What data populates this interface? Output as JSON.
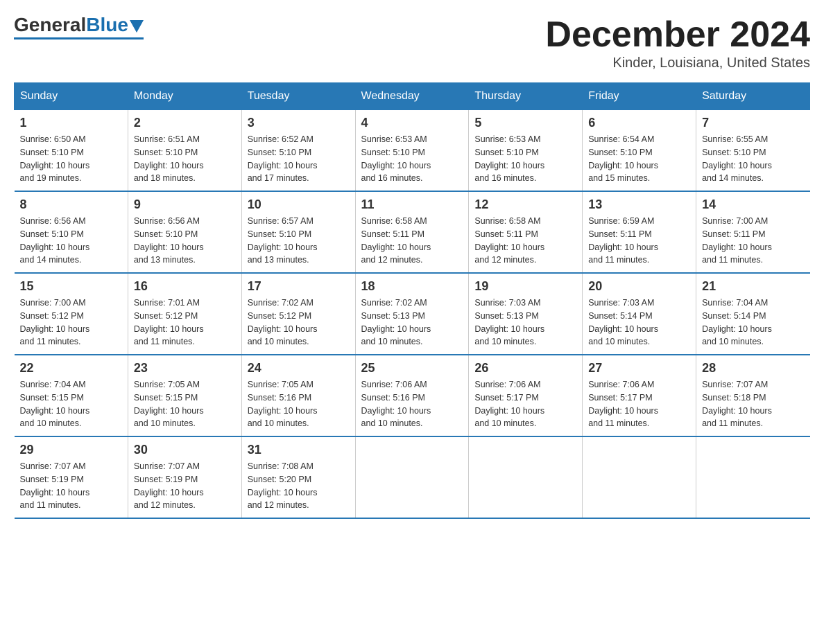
{
  "logo": {
    "general": "General",
    "blue": "Blue"
  },
  "title": "December 2024",
  "location": "Kinder, Louisiana, United States",
  "days_of_week": [
    "Sunday",
    "Monday",
    "Tuesday",
    "Wednesday",
    "Thursday",
    "Friday",
    "Saturday"
  ],
  "weeks": [
    [
      {
        "day": "1",
        "sunrise": "6:50 AM",
        "sunset": "5:10 PM",
        "daylight": "10 hours and 19 minutes."
      },
      {
        "day": "2",
        "sunrise": "6:51 AM",
        "sunset": "5:10 PM",
        "daylight": "10 hours and 18 minutes."
      },
      {
        "day": "3",
        "sunrise": "6:52 AM",
        "sunset": "5:10 PM",
        "daylight": "10 hours and 17 minutes."
      },
      {
        "day": "4",
        "sunrise": "6:53 AM",
        "sunset": "5:10 PM",
        "daylight": "10 hours and 16 minutes."
      },
      {
        "day": "5",
        "sunrise": "6:53 AM",
        "sunset": "5:10 PM",
        "daylight": "10 hours and 16 minutes."
      },
      {
        "day": "6",
        "sunrise": "6:54 AM",
        "sunset": "5:10 PM",
        "daylight": "10 hours and 15 minutes."
      },
      {
        "day": "7",
        "sunrise": "6:55 AM",
        "sunset": "5:10 PM",
        "daylight": "10 hours and 14 minutes."
      }
    ],
    [
      {
        "day": "8",
        "sunrise": "6:56 AM",
        "sunset": "5:10 PM",
        "daylight": "10 hours and 14 minutes."
      },
      {
        "day": "9",
        "sunrise": "6:56 AM",
        "sunset": "5:10 PM",
        "daylight": "10 hours and 13 minutes."
      },
      {
        "day": "10",
        "sunrise": "6:57 AM",
        "sunset": "5:10 PM",
        "daylight": "10 hours and 13 minutes."
      },
      {
        "day": "11",
        "sunrise": "6:58 AM",
        "sunset": "5:11 PM",
        "daylight": "10 hours and 12 minutes."
      },
      {
        "day": "12",
        "sunrise": "6:58 AM",
        "sunset": "5:11 PM",
        "daylight": "10 hours and 12 minutes."
      },
      {
        "day": "13",
        "sunrise": "6:59 AM",
        "sunset": "5:11 PM",
        "daylight": "10 hours and 11 minutes."
      },
      {
        "day": "14",
        "sunrise": "7:00 AM",
        "sunset": "5:11 PM",
        "daylight": "10 hours and 11 minutes."
      }
    ],
    [
      {
        "day": "15",
        "sunrise": "7:00 AM",
        "sunset": "5:12 PM",
        "daylight": "10 hours and 11 minutes."
      },
      {
        "day": "16",
        "sunrise": "7:01 AM",
        "sunset": "5:12 PM",
        "daylight": "10 hours and 11 minutes."
      },
      {
        "day": "17",
        "sunrise": "7:02 AM",
        "sunset": "5:12 PM",
        "daylight": "10 hours and 10 minutes."
      },
      {
        "day": "18",
        "sunrise": "7:02 AM",
        "sunset": "5:13 PM",
        "daylight": "10 hours and 10 minutes."
      },
      {
        "day": "19",
        "sunrise": "7:03 AM",
        "sunset": "5:13 PM",
        "daylight": "10 hours and 10 minutes."
      },
      {
        "day": "20",
        "sunrise": "7:03 AM",
        "sunset": "5:14 PM",
        "daylight": "10 hours and 10 minutes."
      },
      {
        "day": "21",
        "sunrise": "7:04 AM",
        "sunset": "5:14 PM",
        "daylight": "10 hours and 10 minutes."
      }
    ],
    [
      {
        "day": "22",
        "sunrise": "7:04 AM",
        "sunset": "5:15 PM",
        "daylight": "10 hours and 10 minutes."
      },
      {
        "day": "23",
        "sunrise": "7:05 AM",
        "sunset": "5:15 PM",
        "daylight": "10 hours and 10 minutes."
      },
      {
        "day": "24",
        "sunrise": "7:05 AM",
        "sunset": "5:16 PM",
        "daylight": "10 hours and 10 minutes."
      },
      {
        "day": "25",
        "sunrise": "7:06 AM",
        "sunset": "5:16 PM",
        "daylight": "10 hours and 10 minutes."
      },
      {
        "day": "26",
        "sunrise": "7:06 AM",
        "sunset": "5:17 PM",
        "daylight": "10 hours and 10 minutes."
      },
      {
        "day": "27",
        "sunrise": "7:06 AM",
        "sunset": "5:17 PM",
        "daylight": "10 hours and 11 minutes."
      },
      {
        "day": "28",
        "sunrise": "7:07 AM",
        "sunset": "5:18 PM",
        "daylight": "10 hours and 11 minutes."
      }
    ],
    [
      {
        "day": "29",
        "sunrise": "7:07 AM",
        "sunset": "5:19 PM",
        "daylight": "10 hours and 11 minutes."
      },
      {
        "day": "30",
        "sunrise": "7:07 AM",
        "sunset": "5:19 PM",
        "daylight": "10 hours and 12 minutes."
      },
      {
        "day": "31",
        "sunrise": "7:08 AM",
        "sunset": "5:20 PM",
        "daylight": "10 hours and 12 minutes."
      },
      null,
      null,
      null,
      null
    ]
  ],
  "labels": {
    "sunrise": "Sunrise:",
    "sunset": "Sunset:",
    "daylight": "Daylight: 10 hours"
  }
}
